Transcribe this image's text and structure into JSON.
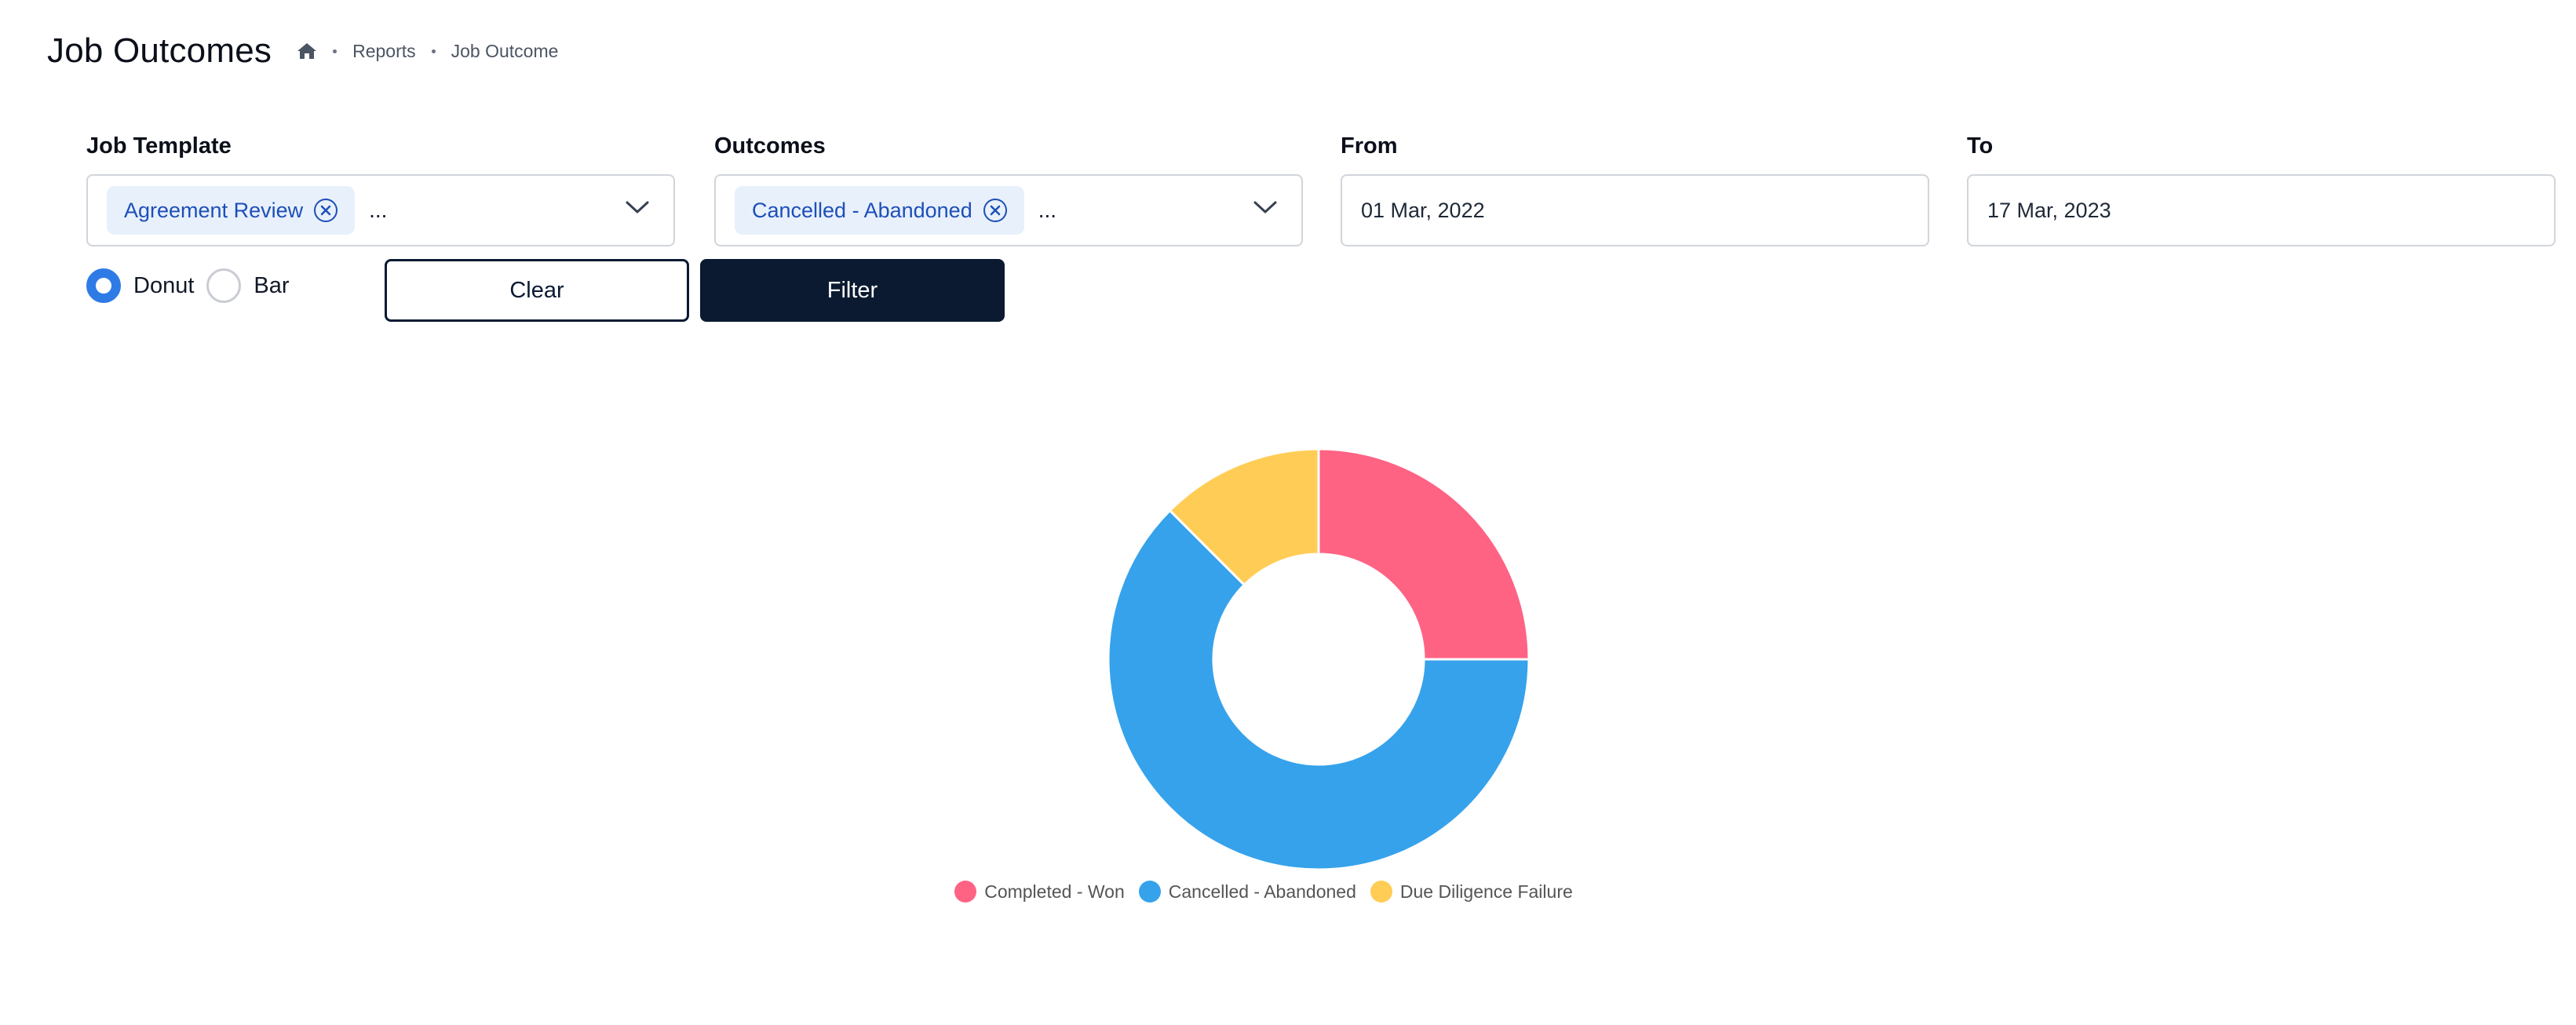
{
  "header": {
    "title": "Job Outcomes",
    "breadcrumb": [
      "Reports",
      "Job Outcome"
    ]
  },
  "filters": {
    "job_template": {
      "label": "Job Template",
      "chip": "Agreement Review",
      "more": "..."
    },
    "outcomes": {
      "label": "Outcomes",
      "chip": "Cancelled - Abandoned",
      "more": "..."
    },
    "from": {
      "label": "From",
      "value": "01 Mar, 2022"
    },
    "to": {
      "label": "To",
      "value": "17 Mar, 2023"
    }
  },
  "view": {
    "options": [
      {
        "label": "Donut",
        "selected": true
      },
      {
        "label": "Bar",
        "selected": false
      }
    ]
  },
  "buttons": {
    "clear": "Clear",
    "filter": "Filter"
  },
  "chart_data": {
    "type": "pie",
    "variant": "donut",
    "categories": [
      "Completed - Won",
      "Cancelled - Abandoned",
      "Due Diligence Failure"
    ],
    "values": [
      25,
      62.5,
      12.5
    ],
    "colors": [
      "#ff6384",
      "#36a2eb",
      "#ffcd56"
    ],
    "legend_position": "bottom",
    "title": ""
  }
}
